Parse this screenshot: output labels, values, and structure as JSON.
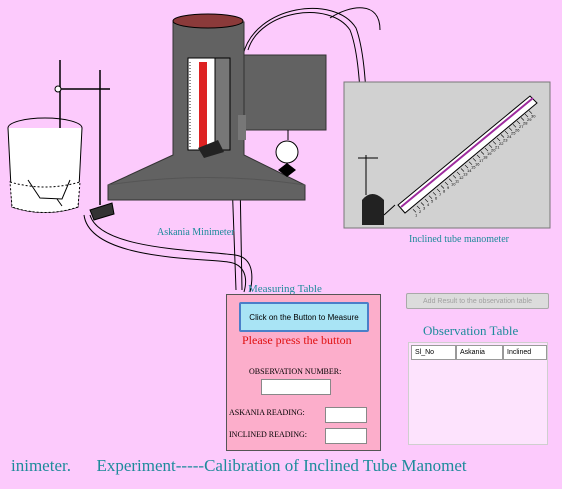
{
  "labels": {
    "askania": "Askania Minimeter",
    "inclined": "Inclined tube manometer"
  },
  "measuring": {
    "title": "Measuring Table",
    "button_label": "Click on the Button to Measure",
    "prompt": "Please press the button",
    "obs_number_label": "OBSERVATION NUMBER:",
    "obs_number_value": "",
    "askania_reading_label": "ASKANIA READING:",
    "askania_reading_value": "",
    "inclined_reading_label": "INCLINED READING:",
    "inclined_reading_value": ""
  },
  "observation": {
    "add_button_label": "Add Result to the observation table",
    "title": "Observation Table",
    "columns": [
      "Sl_No",
      "Askania",
      "Inclined"
    ]
  },
  "footer": {
    "marquee": "inimeter.      Experiment-----Calibration of Inclined Tube Manomet"
  },
  "scale_numbers": [
    "1",
    "2",
    "3",
    "4",
    "5",
    "6",
    "7",
    "8",
    "9",
    "10",
    "11",
    "12",
    "13",
    "14",
    "15",
    "16",
    "17",
    "18",
    "19",
    "20",
    "21",
    "22",
    "23",
    "24",
    "25",
    "26",
    "27",
    "28",
    "29",
    "30"
  ],
  "colors": {
    "background": "#fccafc",
    "label_teal": "#1d8b9b",
    "prompt_red": "#e01010",
    "panel_pink": "#fcaecb",
    "button_blue": "#a9e4f5"
  }
}
